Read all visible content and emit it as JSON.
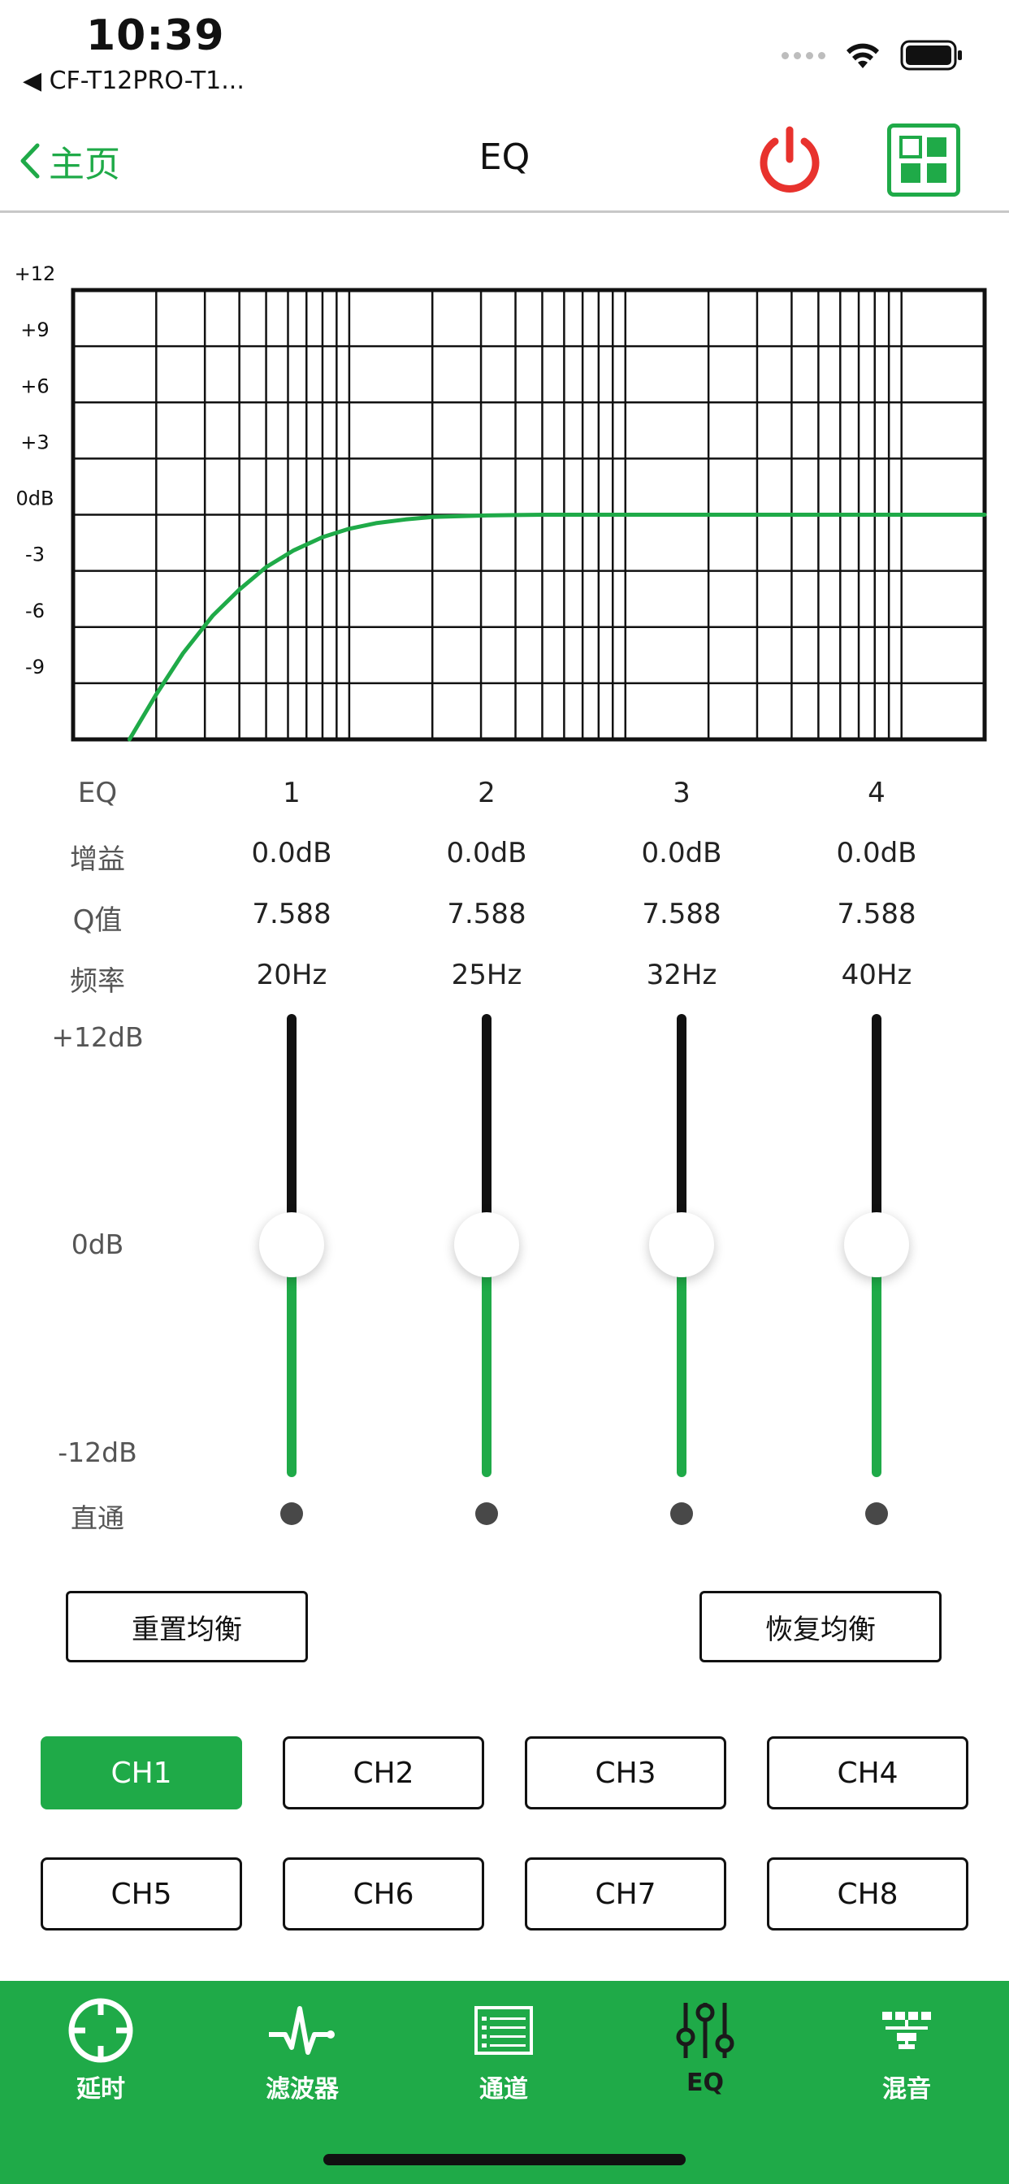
{
  "status_bar": {
    "time": "10:39",
    "back_app": "◀ CF-T12PRO-T1..."
  },
  "nav": {
    "back_label": "主页",
    "title": "EQ",
    "power_color": "#e8322d",
    "accent": "#1faa48"
  },
  "chart_data": {
    "type": "line",
    "ylabels": [
      "+12",
      "+9",
      "+6",
      "+3",
      "0dB",
      "-3",
      "-6",
      "-9"
    ],
    "ylim": [
      -12,
      12
    ],
    "x_scale": "log",
    "xlim": [
      10,
      20000
    ],
    "grid": true,
    "series": [
      {
        "color": "#1faa48",
        "x": [
          16,
          20,
          25,
          32,
          40,
          50,
          63,
          80,
          100,
          125,
          160,
          200,
          315,
          500,
          1000,
          20000
        ],
        "y": [
          -12,
          -9.6,
          -7.4,
          -5.4,
          -4.0,
          -2.8,
          -1.9,
          -1.2,
          -0.75,
          -0.45,
          -0.25,
          -0.12,
          -0.04,
          0,
          0,
          0
        ]
      }
    ]
  },
  "params": {
    "eq_label": "EQ",
    "gain_label": "增益",
    "q_label": "Q值",
    "freq_label": "频率",
    "bands": [
      {
        "num": "1",
        "gain": "0.0dB",
        "q": "7.588",
        "freq": "20Hz"
      },
      {
        "num": "2",
        "gain": "0.0dB",
        "q": "7.588",
        "freq": "25Hz"
      },
      {
        "num": "3",
        "gain": "0.0dB",
        "q": "7.588",
        "freq": "32Hz"
      },
      {
        "num": "4",
        "gain": "0.0dB",
        "q": "7.588",
        "freq": "40Hz"
      }
    ]
  },
  "scale": {
    "top": "+12dB",
    "mid": "0dB",
    "bottom": "-12dB",
    "bypass": "直通"
  },
  "actions": {
    "reset": "重置均衡",
    "restore": "恢复均衡"
  },
  "channels": [
    "CH1",
    "CH2",
    "CH3",
    "CH4",
    "CH5",
    "CH6",
    "CH7",
    "CH8"
  ],
  "active_channel": "CH1",
  "tabs": [
    {
      "label": "延时",
      "icon": "crosshair-icon"
    },
    {
      "label": "滤波器",
      "icon": "waveform-icon"
    },
    {
      "label": "通道",
      "icon": "list-icon"
    },
    {
      "label": "EQ",
      "icon": "sliders-icon"
    },
    {
      "label": "混音",
      "icon": "network-icon"
    }
  ]
}
